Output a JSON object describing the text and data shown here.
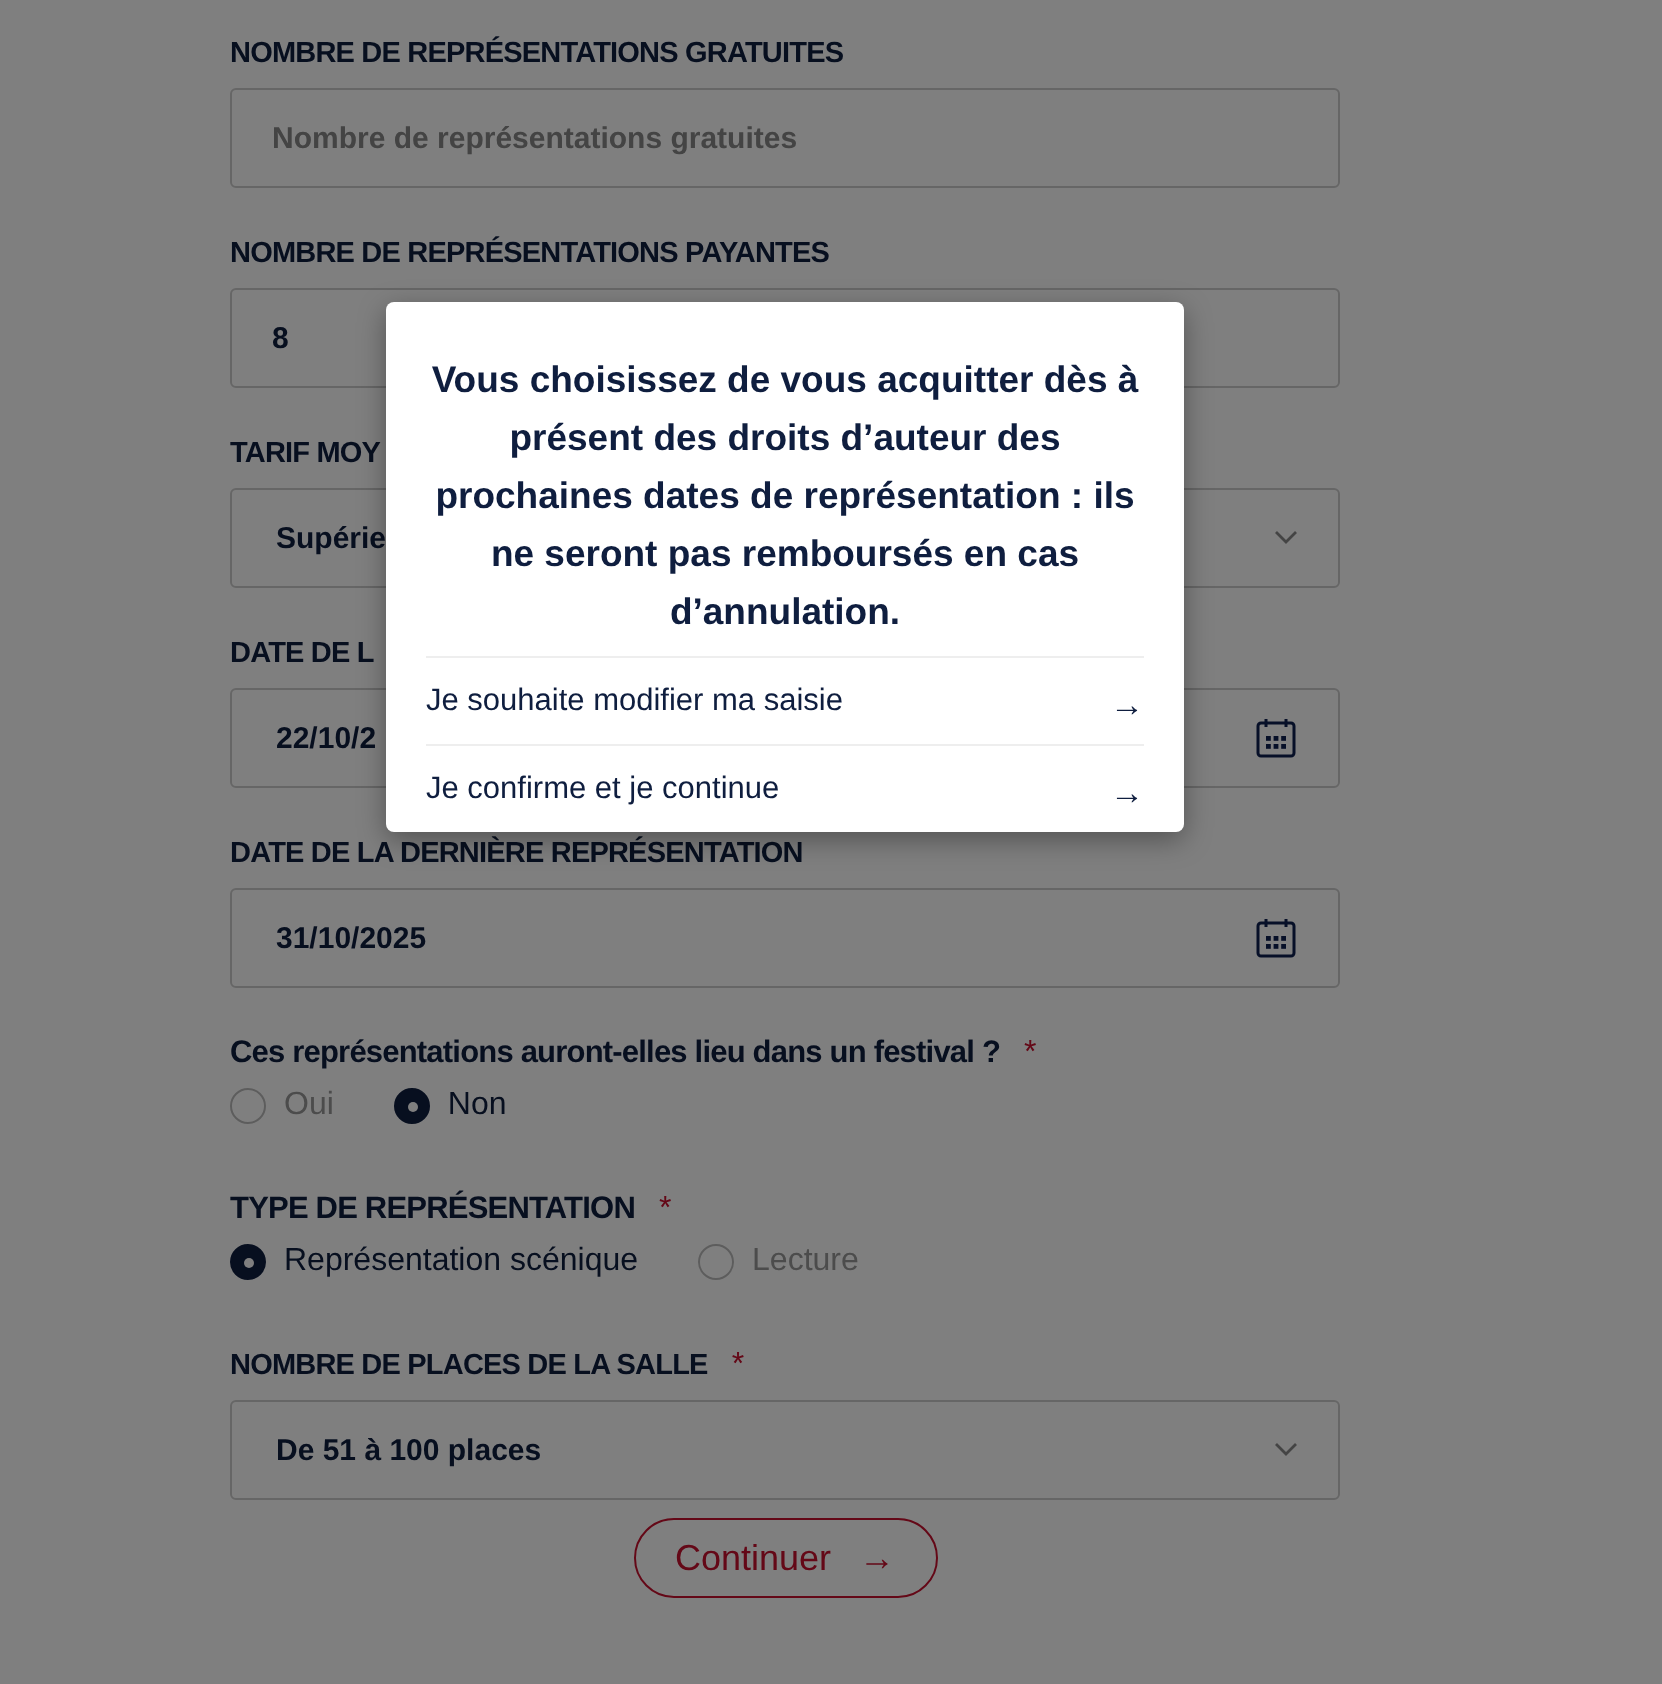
{
  "fields": [
    {
      "kind": "input",
      "label": "NOMBRE DE REPRÉSENTATIONS GRATUITES",
      "required": false,
      "placeholder": "Nombre de représentations gratuites"
    },
    {
      "kind": "input",
      "label": "NOMBRE DE REPRÉSENTATIONS PAYANTES",
      "required": false,
      "value": "8"
    },
    {
      "kind": "select",
      "label": "TARIF MOY",
      "required": false,
      "value": "Supérie"
    },
    {
      "kind": "date",
      "label": "DATE DE L",
      "required": false,
      "value": "22/10/2"
    },
    {
      "kind": "date",
      "label": "DATE DE LA DERNIÈRE REPRÉSENTATION",
      "required": false,
      "value": "31/10/2025"
    },
    {
      "kind": "radio",
      "label": "Ces représentations auront-elles lieu dans un festival ?",
      "required": true,
      "options": [
        {
          "label": "Oui",
          "selected": false
        },
        {
          "label": "Non",
          "selected": true
        }
      ]
    },
    {
      "kind": "radio",
      "label": "TYPE DE REPRÉSENTATION",
      "required": true,
      "options": [
        {
          "label": "Représentation scénique",
          "selected": true
        },
        {
          "label": "Lecture",
          "selected": false
        }
      ]
    },
    {
      "kind": "select",
      "label": "NOMBRE DE PLACES DE LA SALLE",
      "required": true,
      "value": "De 51 à 100 places"
    }
  ],
  "required_mark": "*",
  "continue_button": {
    "label": "Continuer",
    "arrow": "→"
  },
  "modal": {
    "message": "Vous choisissez de vous acquitter dès à présent des droits d’auteur des prochaines dates de représentation : ils ne seront pas remboursés en cas d’annulation.",
    "actions": [
      {
        "label": "Je souhaite modifier ma saisie",
        "arrow": "→"
      },
      {
        "label": "Je confirme et je continue",
        "arrow": "→"
      }
    ]
  }
}
